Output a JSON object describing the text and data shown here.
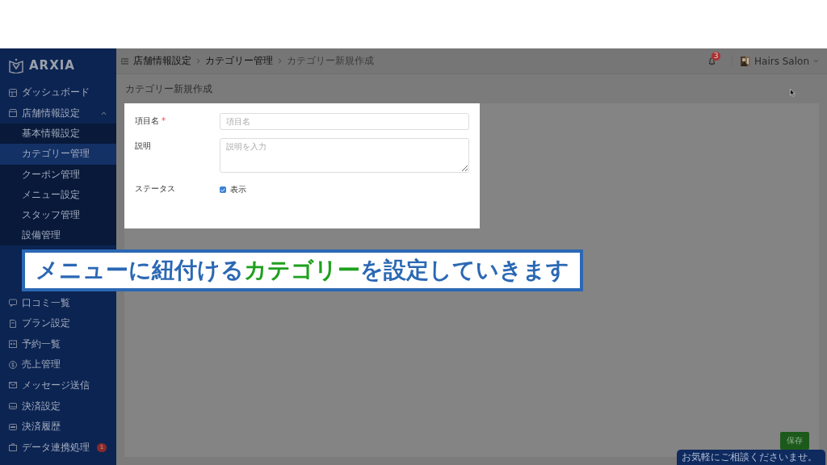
{
  "sidebar": {
    "logo": "ARXIA",
    "items": [
      {
        "label": "ダッシュボード",
        "selected": false
      },
      {
        "label": "店舗情報設定",
        "selected": false,
        "expanded": true,
        "children": [
          {
            "label": "基本情報設定",
            "selected": false
          },
          {
            "label": "カテゴリー管理",
            "selected": true
          },
          {
            "label": "クーポン管理",
            "selected": false
          },
          {
            "label": "メニュー設定",
            "selected": false
          },
          {
            "label": "スタッフ管理",
            "selected": false
          },
          {
            "label": "設備管理",
            "selected": false
          }
        ]
      },
      {
        "label": "口コミ一覧",
        "selected": false
      },
      {
        "label": "プラン設定",
        "selected": false
      },
      {
        "label": "予約一覧",
        "selected": false
      },
      {
        "label": "売上管理",
        "selected": false
      },
      {
        "label": "メッセージ送信",
        "selected": false
      },
      {
        "label": "決済設定",
        "selected": false
      },
      {
        "label": "決済履歴",
        "selected": false
      },
      {
        "label": "データ連携処理",
        "selected": false,
        "badge": "1"
      }
    ]
  },
  "header": {
    "breadcrumb": [
      "店舗情報設定",
      "カテゴリー管理",
      "カテゴリー新規作成"
    ],
    "notification_count": "3",
    "user": "Hairs Salon"
  },
  "page_title": "カテゴリー新規作成",
  "form": {
    "fields": [
      {
        "kind": "text",
        "label": "項目名",
        "required_mark": "*",
        "placeholder": "項目名"
      },
      {
        "kind": "textarea",
        "label": "説明",
        "placeholder": "説明を入力"
      },
      {
        "kind": "checkbox",
        "label": "ステータス",
        "option": "表示",
        "checked": true
      }
    ]
  },
  "save_button": "保存",
  "chat": "お気軽にご相談くださいませ。",
  "caption": [
    {
      "text": "メニューに紐付ける",
      "highlight": false
    },
    {
      "text": "カテゴリー",
      "highlight": true
    },
    {
      "text": "を設定していきます",
      "highlight": false
    }
  ]
}
